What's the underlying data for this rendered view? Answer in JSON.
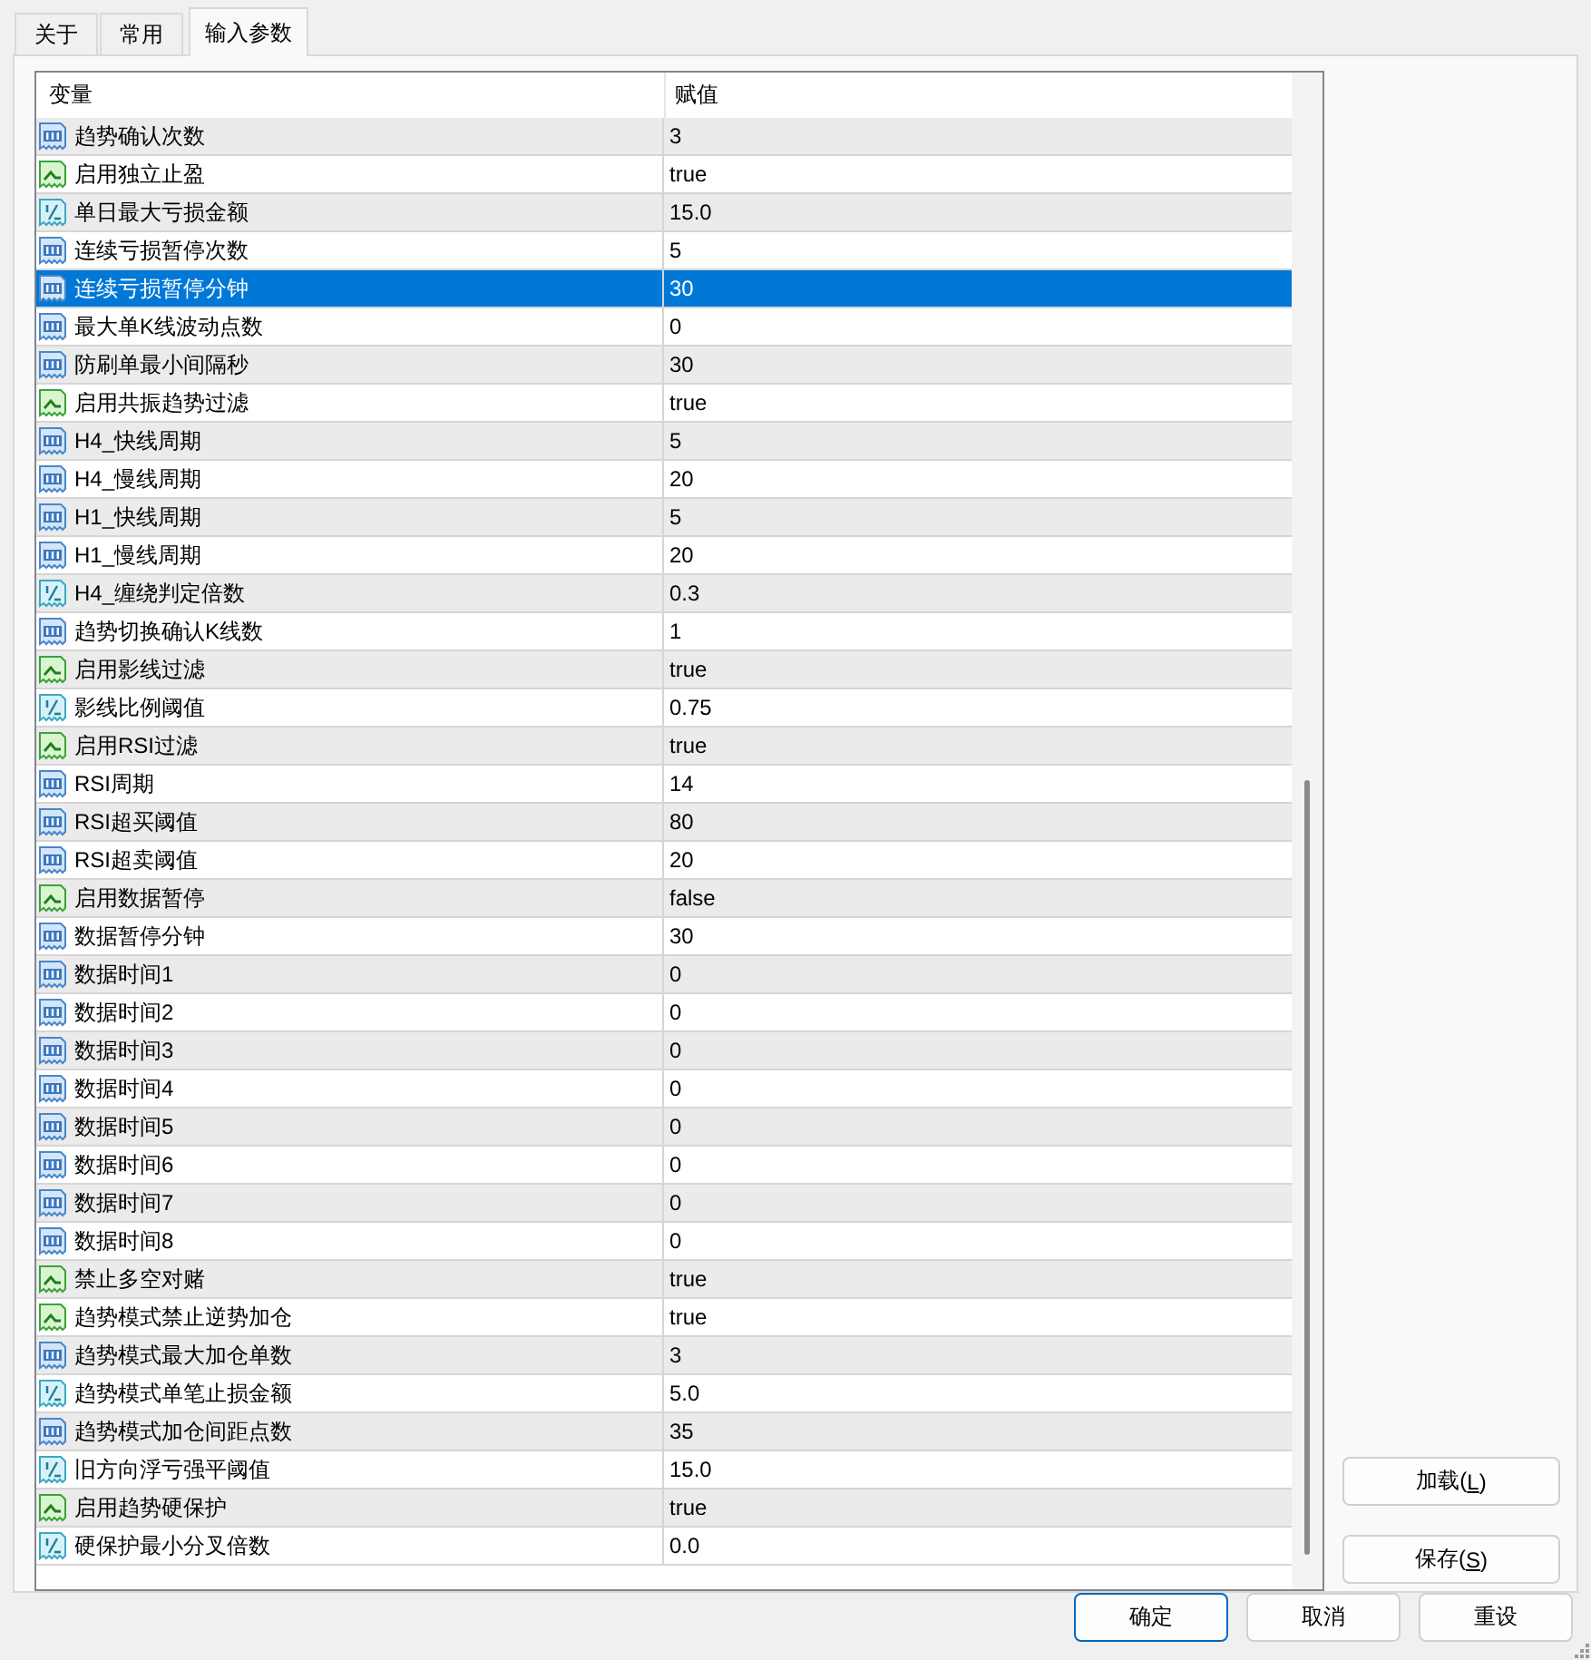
{
  "tabs": [
    {
      "label": "关于",
      "selected": false
    },
    {
      "label": "常用",
      "selected": false
    },
    {
      "label": "输入参数",
      "selected": true
    }
  ],
  "table": {
    "columns": [
      "变量",
      "赋值"
    ],
    "rows": [
      {
        "kind": "int",
        "name": "趋势确认次数",
        "value": "3",
        "selected": false
      },
      {
        "kind": "bool",
        "name": "启用独立止盈",
        "value": "true",
        "selected": false
      },
      {
        "kind": "double",
        "name": "单日最大亏损金额",
        "value": "15.0",
        "selected": false
      },
      {
        "kind": "int",
        "name": "连续亏损暂停次数",
        "value": "5",
        "selected": false
      },
      {
        "kind": "int",
        "name": "连续亏损暂停分钟",
        "value": "30",
        "selected": true
      },
      {
        "kind": "int",
        "name": "最大单K线波动点数",
        "value": "0",
        "selected": false
      },
      {
        "kind": "int",
        "name": "防刷单最小间隔秒",
        "value": "30",
        "selected": false
      },
      {
        "kind": "bool",
        "name": "启用共振趋势过滤",
        "value": "true",
        "selected": false
      },
      {
        "kind": "int",
        "name": "H4_快线周期",
        "value": "5",
        "selected": false
      },
      {
        "kind": "int",
        "name": "H4_慢线周期",
        "value": "20",
        "selected": false
      },
      {
        "kind": "int",
        "name": "H1_快线周期",
        "value": "5",
        "selected": false
      },
      {
        "kind": "int",
        "name": "H1_慢线周期",
        "value": "20",
        "selected": false
      },
      {
        "kind": "double",
        "name": "H4_缠绕判定倍数",
        "value": "0.3",
        "selected": false
      },
      {
        "kind": "int",
        "name": "趋势切换确认K线数",
        "value": "1",
        "selected": false
      },
      {
        "kind": "bool",
        "name": "启用影线过滤",
        "value": "true",
        "selected": false
      },
      {
        "kind": "double",
        "name": "影线比例阈值",
        "value": "0.75",
        "selected": false
      },
      {
        "kind": "bool",
        "name": "启用RSI过滤",
        "value": "true",
        "selected": false
      },
      {
        "kind": "int",
        "name": "RSI周期",
        "value": "14",
        "selected": false
      },
      {
        "kind": "int",
        "name": "RSI超买阈值",
        "value": "80",
        "selected": false
      },
      {
        "kind": "int",
        "name": "RSI超卖阈值",
        "value": "20",
        "selected": false
      },
      {
        "kind": "bool",
        "name": "启用数据暂停",
        "value": "false",
        "selected": false
      },
      {
        "kind": "int",
        "name": "数据暂停分钟",
        "value": "30",
        "selected": false
      },
      {
        "kind": "int",
        "name": "数据时间1",
        "value": "0",
        "selected": false
      },
      {
        "kind": "int",
        "name": "数据时间2",
        "value": "0",
        "selected": false
      },
      {
        "kind": "int",
        "name": "数据时间3",
        "value": "0",
        "selected": false
      },
      {
        "kind": "int",
        "name": "数据时间4",
        "value": "0",
        "selected": false
      },
      {
        "kind": "int",
        "name": "数据时间5",
        "value": "0",
        "selected": false
      },
      {
        "kind": "int",
        "name": "数据时间6",
        "value": "0",
        "selected": false
      },
      {
        "kind": "int",
        "name": "数据时间7",
        "value": "0",
        "selected": false
      },
      {
        "kind": "int",
        "name": "数据时间8",
        "value": "0",
        "selected": false
      },
      {
        "kind": "bool",
        "name": "禁止多空对赌",
        "value": "true",
        "selected": false
      },
      {
        "kind": "bool",
        "name": "趋势模式禁止逆势加仓",
        "value": "true",
        "selected": false
      },
      {
        "kind": "int",
        "name": "趋势模式最大加仓单数",
        "value": "3",
        "selected": false
      },
      {
        "kind": "double",
        "name": "趋势模式单笔止损金额",
        "value": "5.0",
        "selected": false
      },
      {
        "kind": "int",
        "name": "趋势模式加仓间距点数",
        "value": "35",
        "selected": false
      },
      {
        "kind": "double",
        "name": "旧方向浮亏强平阈值",
        "value": "15.0",
        "selected": false
      },
      {
        "kind": "bool",
        "name": "启用趋势硬保护",
        "value": "true",
        "selected": false
      },
      {
        "kind": "double",
        "name": "硬保护最小分叉倍数",
        "value": "0.0",
        "selected": false
      }
    ]
  },
  "side_buttons": [
    {
      "label": "加载(",
      "mnemonic": "L",
      "label_end": ")"
    },
    {
      "label": "保存(",
      "mnemonic": "S",
      "label_end": ")"
    }
  ],
  "buttons": [
    {
      "label": "确定",
      "focused": true
    },
    {
      "label": "取消",
      "focused": false
    },
    {
      "label": "重设",
      "focused": false
    }
  ]
}
